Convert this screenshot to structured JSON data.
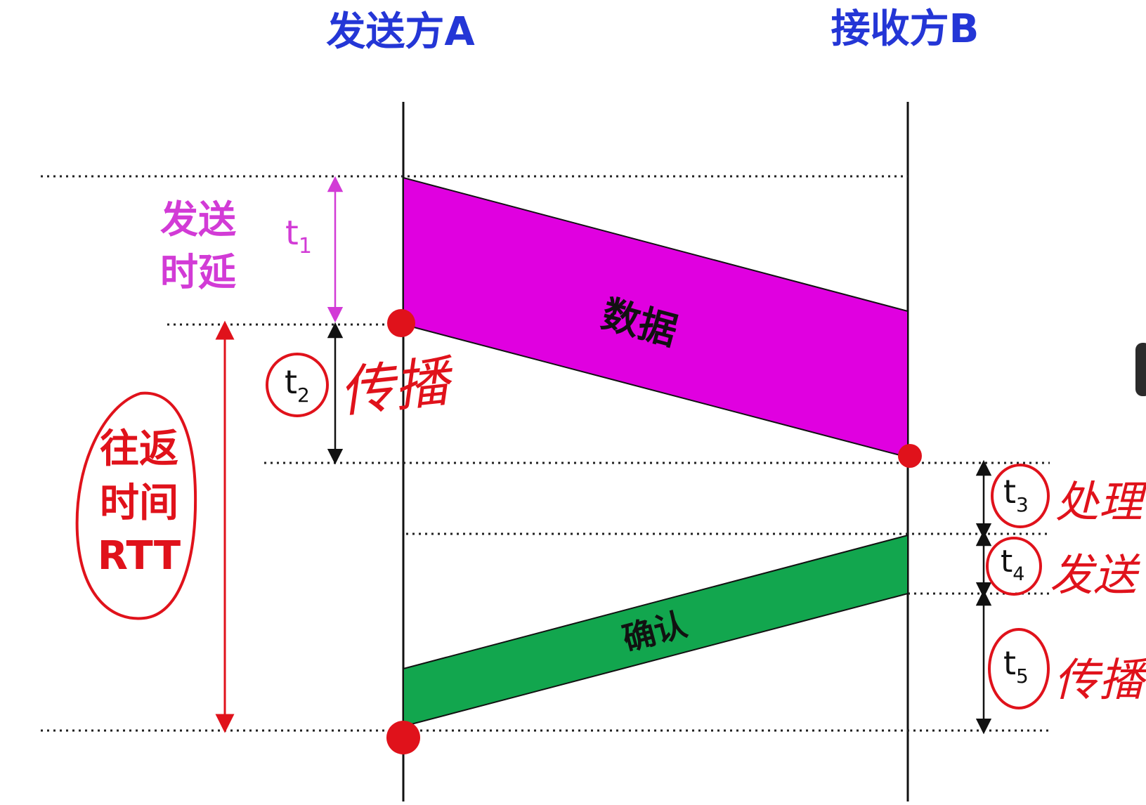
{
  "sender": {
    "title": "发送方A"
  },
  "receiver": {
    "title": "接收方B"
  },
  "labels": {
    "transmission_delay_line1": "发送",
    "transmission_delay_line2": "时延",
    "t1": "t",
    "t1_sub": "1",
    "t2": "t",
    "t2_sub": "2",
    "t2_note": "传播",
    "rtt_line1": "往返",
    "rtt_line2": "时间",
    "rtt_line3": "RTT",
    "t3": "t",
    "t3_sub": "3",
    "t3_note": "处理",
    "t4": "t",
    "t4_sub": "4",
    "t4_note": "发送",
    "t5": "t",
    "t5_sub": "5",
    "t5_note": "传播"
  },
  "frames": {
    "data_label": "数据",
    "ack_label": "确认"
  },
  "colors": {
    "title_blue": "#2436d6",
    "magenta": "#e000e0",
    "label_magenta": "#d23bd6",
    "ack_green": "#12a64e",
    "annotation_red": "#e0121b",
    "line_black": "#111111"
  }
}
